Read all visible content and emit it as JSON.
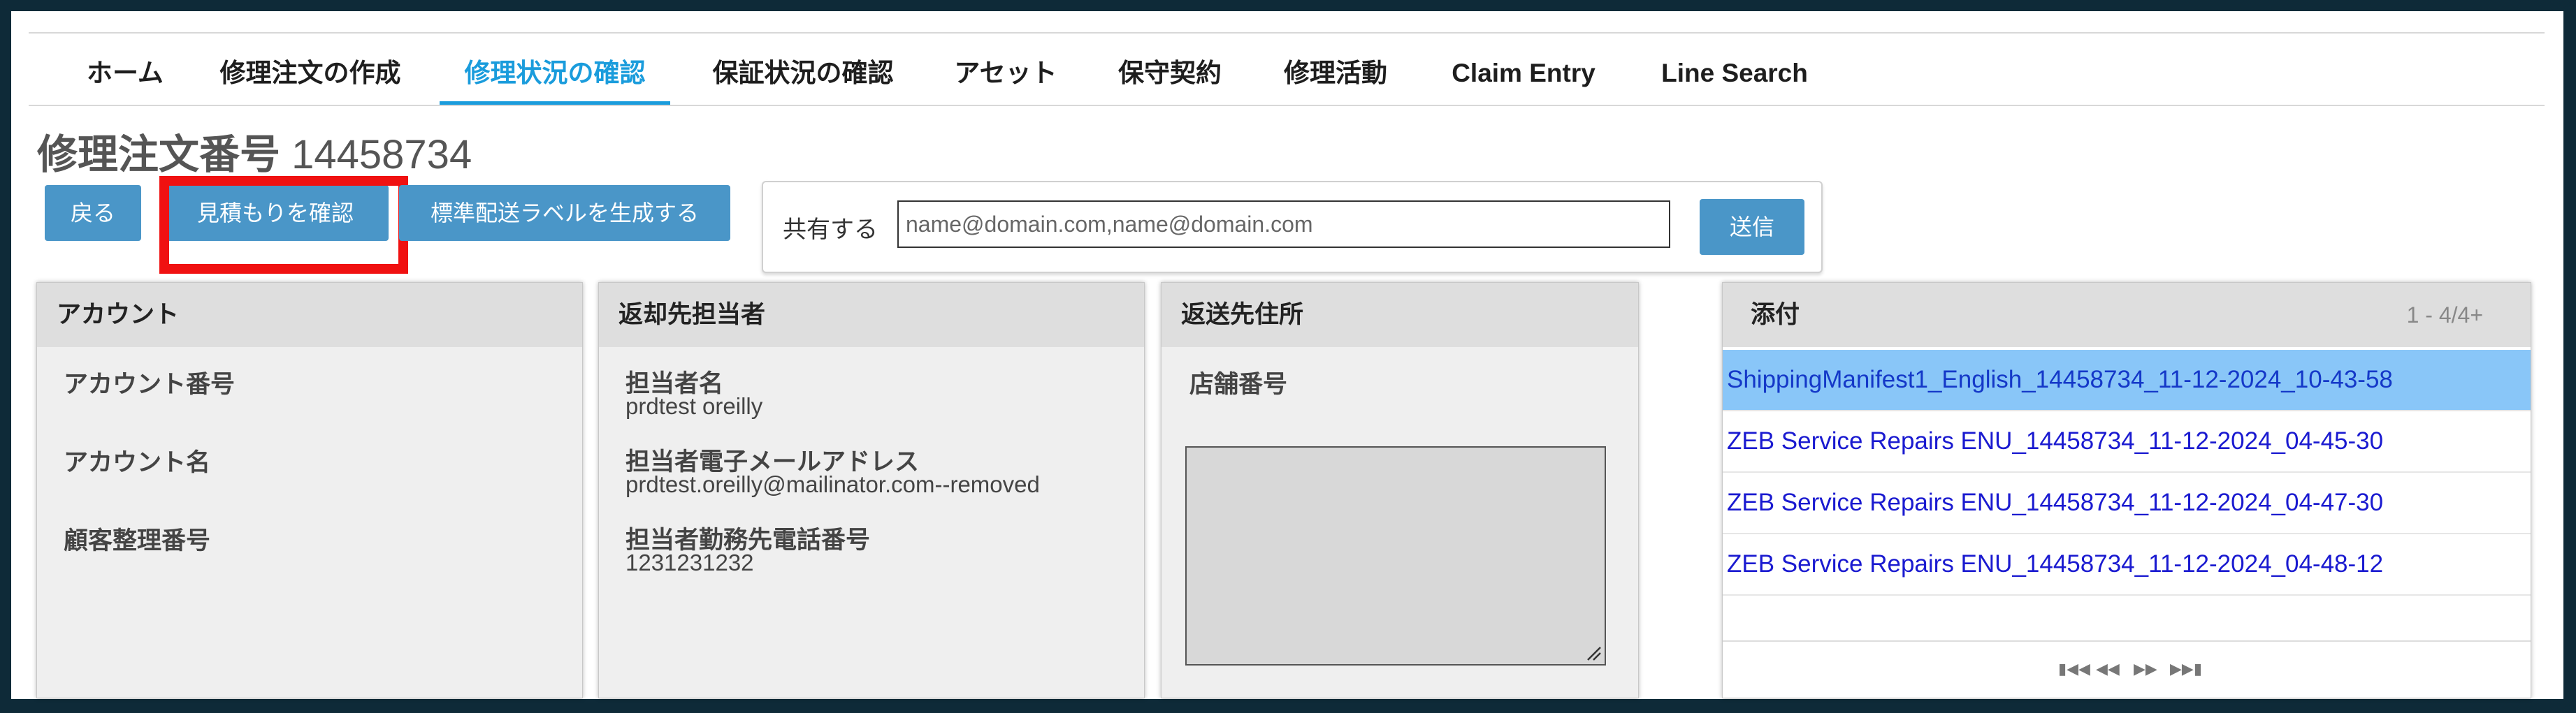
{
  "nav": {
    "tabs": [
      {
        "label": "ホーム"
      },
      {
        "label": "修理注文の作成"
      },
      {
        "label": "修理状況の確認",
        "active": true
      },
      {
        "label": "保証状況の確認"
      },
      {
        "label": "アセット"
      },
      {
        "label": "保守契約"
      },
      {
        "label": "修理活動"
      },
      {
        "label": "Claim Entry"
      },
      {
        "label": "Line Search"
      }
    ]
  },
  "page": {
    "title_label": "修理注文番号",
    "order_number": "14458734"
  },
  "toolbar": {
    "back_label": "戻る",
    "quote_label": "見積もりを確認",
    "label_gen_label": "標準配送ラベルを生成する"
  },
  "share": {
    "label": "共有する",
    "placeholder": "name@domain.com,name@domain.com",
    "send_label": "送信"
  },
  "account": {
    "header": "アカウント",
    "number_label": "アカウント番号",
    "name_label": "アカウント名",
    "customer_ref_label": "顧客整理番号"
  },
  "contact": {
    "header": "返却先担当者",
    "name_label": "担当者名",
    "name_value": "prdtest oreilly",
    "email_label": "担当者電子メールアドレス",
    "email_value": "prdtest.oreilly@mailinator.com--removed",
    "phone_label": "担当者勤務先電話番号",
    "phone_value": "1231231232"
  },
  "address": {
    "header": "返送先住所",
    "store_label": "店舗番号"
  },
  "attachments": {
    "header": "添付",
    "count": "1 - 4/4+",
    "items": [
      "ShippingManifest1_English_14458734_11-12-2024_10-43-58",
      "ZEB Service Repairs ENU_14458734_11-12-2024_04-45-30",
      "ZEB Service Repairs ENU_14458734_11-12-2024_04-47-30",
      "ZEB Service Repairs ENU_14458734_11-12-2024_04-48-12"
    ],
    "selected_index": 0
  },
  "colors": {
    "accent": "#1a9cdc",
    "button": "#4a96c8",
    "highlight": "#f01111",
    "selected_row": "#89c6f8"
  }
}
